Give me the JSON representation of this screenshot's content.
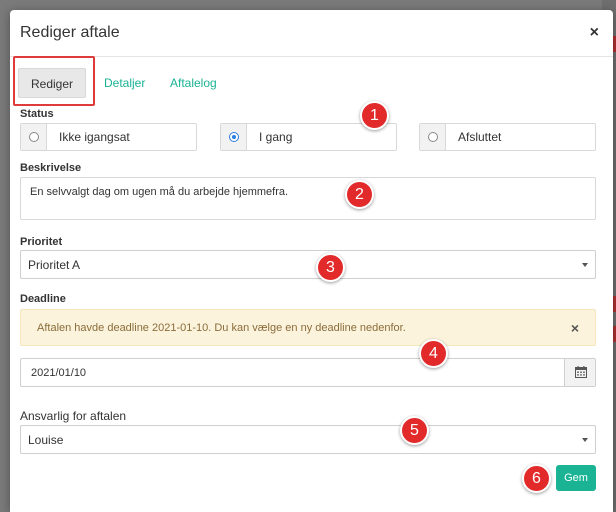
{
  "dialog": {
    "title": "Rediger aftale",
    "close_icon": "close-icon"
  },
  "tabs": [
    {
      "label": "Rediger",
      "active": true
    },
    {
      "label": "Detaljer",
      "active": false
    },
    {
      "label": "Aftalelog",
      "active": false
    }
  ],
  "status": {
    "label": "Status",
    "options": [
      {
        "label": "Ikke igangsat",
        "checked": false
      },
      {
        "label": "I gang",
        "checked": true
      },
      {
        "label": "Afsluttet",
        "checked": false
      }
    ]
  },
  "description": {
    "label": "Beskrivelse",
    "value": "En selvvalgt dag om ugen må du arbejde hjemmefra."
  },
  "priority": {
    "label": "Prioritet",
    "value": "Prioritet A"
  },
  "deadline": {
    "label": "Deadline",
    "alert": "Aftalen havde deadline 2021-01-10. Du kan vælge en ny deadline nedenfor.",
    "value": "2021/01/10",
    "calendar_icon": "calendar-icon"
  },
  "responsible": {
    "label": "Ansvarlig for aftalen",
    "value": "Louise"
  },
  "save_label": "Gem",
  "badges": [
    "1",
    "2",
    "3",
    "4",
    "5",
    "6"
  ],
  "colors": {
    "accent": "#1ab394",
    "badge": "#e22a2a",
    "alert_bg": "#fcf3dc",
    "radio_checked": "#2b7de0"
  }
}
